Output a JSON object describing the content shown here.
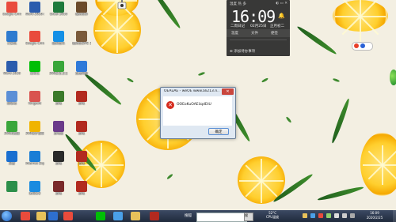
{
  "desktop_icons": [
    {
      "label": "Google Chrome",
      "glyph": "chrome-icon",
      "color": "#e94b3c"
    },
    {
      "label": "Word 2016-Excel",
      "glyph": "word-excel-icon",
      "color": "#2b5cad"
    },
    {
      "label": "Excel 2016",
      "glyph": "excel-icon",
      "color": "#1f7a3c"
    },
    {
      "label": "我的世界",
      "glyph": "minecraft-icon",
      "color": "#6b4a2a"
    },
    {
      "label": "计算机",
      "glyph": "computer-icon",
      "color": "#2e7bcf"
    },
    {
      "label": "Google Chrome",
      "glyph": "chrome-icon",
      "color": "#e94b3c"
    },
    {
      "label": "酷狗音乐",
      "glyph": "kugou-icon",
      "color": "#1590e6"
    },
    {
      "label": "我的世界PE 3DM",
      "glyph": "minecraft-pe-icon",
      "color": "#7a5a3a"
    },
    {
      "label": "Word 2016",
      "glyph": "word-icon",
      "color": "#2b5cad"
    },
    {
      "label": "爱奇艺",
      "glyph": "iqiyi-icon",
      "color": "#00be06"
    },
    {
      "label": "360安全卫士",
      "glyph": "360-icon",
      "color": "#3aa63a"
    },
    {
      "label": "百度网盘",
      "glyph": "baidu-icon",
      "color": "#2f7ad9"
    },
    {
      "label": "回收站",
      "glyph": "recycle-bin-icon",
      "color": "#5b8fd6"
    },
    {
      "label": "Kingsoft",
      "glyph": "kingsoft-icon",
      "color": "#d9534f"
    },
    {
      "label": "游戏",
      "glyph": "game-icon",
      "color": "#3b7a2a"
    },
    {
      "label": "游戏",
      "glyph": "game2-icon",
      "color": "#b22a1f"
    },
    {
      "label": "360浏览器",
      "glyph": "360-browser-icon",
      "color": "#3aa63a"
    },
    {
      "label": "360软件管家",
      "glyph": "360-soft-icon",
      "color": "#f0b400"
    },
    {
      "label": "游戏盒",
      "glyph": "game3-icon",
      "color": "#6a3a8a"
    },
    {
      "label": "游戏",
      "glyph": "game4-icon",
      "color": "#b22a1f"
    },
    {
      "label": "迅雷",
      "glyph": "xunlei-icon",
      "color": "#1a6fd0"
    },
    {
      "label": "Internet Explorer",
      "glyph": "ie-icon",
      "color": "#1a7ed6"
    },
    {
      "label": "游戏",
      "glyph": "game5-icon",
      "color": "#2a2a2a"
    },
    {
      "label": "游戏",
      "glyph": "game6-icon",
      "color": "#b22a1f"
    },
    {
      "label": "",
      "glyph": "app-icon",
      "color": "#2c8f4a"
    },
    {
      "label": "腾讯QQ",
      "glyph": "qq-icon",
      "color": "#1a8be0"
    },
    {
      "label": "游戏",
      "glyph": "game7-icon",
      "color": "#7a2a2a"
    },
    {
      "label": "游戏",
      "glyph": "game8-icon",
      "color": "#b22a1f"
    }
  ],
  "widget": {
    "header": "温度 热 多",
    "controls": "◐ ▭ ✕",
    "time": "16:09",
    "weekday": "二周日记",
    "date": "02月25日",
    "lunar": "正月初二",
    "tools": [
      "温度",
      "文件",
      "便签"
    ],
    "add": "⊕ 添加待办事项"
  },
  "dialog": {
    "title": "OEAuAE - weOE  www.ali213.n...",
    "close": "✕",
    "message": "OOEoKuOAEiiqdEtU",
    "ok": "确定"
  },
  "taskbar": {
    "label": "搜狐",
    "search_placeholder": "",
    "search_button": "搜",
    "temp": "52°C",
    "temp_label": "CPU温度",
    "time": "16:09",
    "date": "2020/2/25",
    "apps": [
      {
        "name": "chrome",
        "color": "#e94b3c"
      },
      {
        "name": "explorer",
        "color": "#e8c25a"
      },
      {
        "name": "media",
        "color": "#2e6fcf"
      },
      {
        "name": "chrome2",
        "color": "#e94b3c"
      },
      {
        "name": "iqiyi",
        "color": "#00be06"
      },
      {
        "name": "feather",
        "color": "#4aa0e8"
      },
      {
        "name": "folder",
        "color": "#e8c25a"
      },
      {
        "name": "game",
        "color": "#b22a1f"
      }
    ]
  }
}
